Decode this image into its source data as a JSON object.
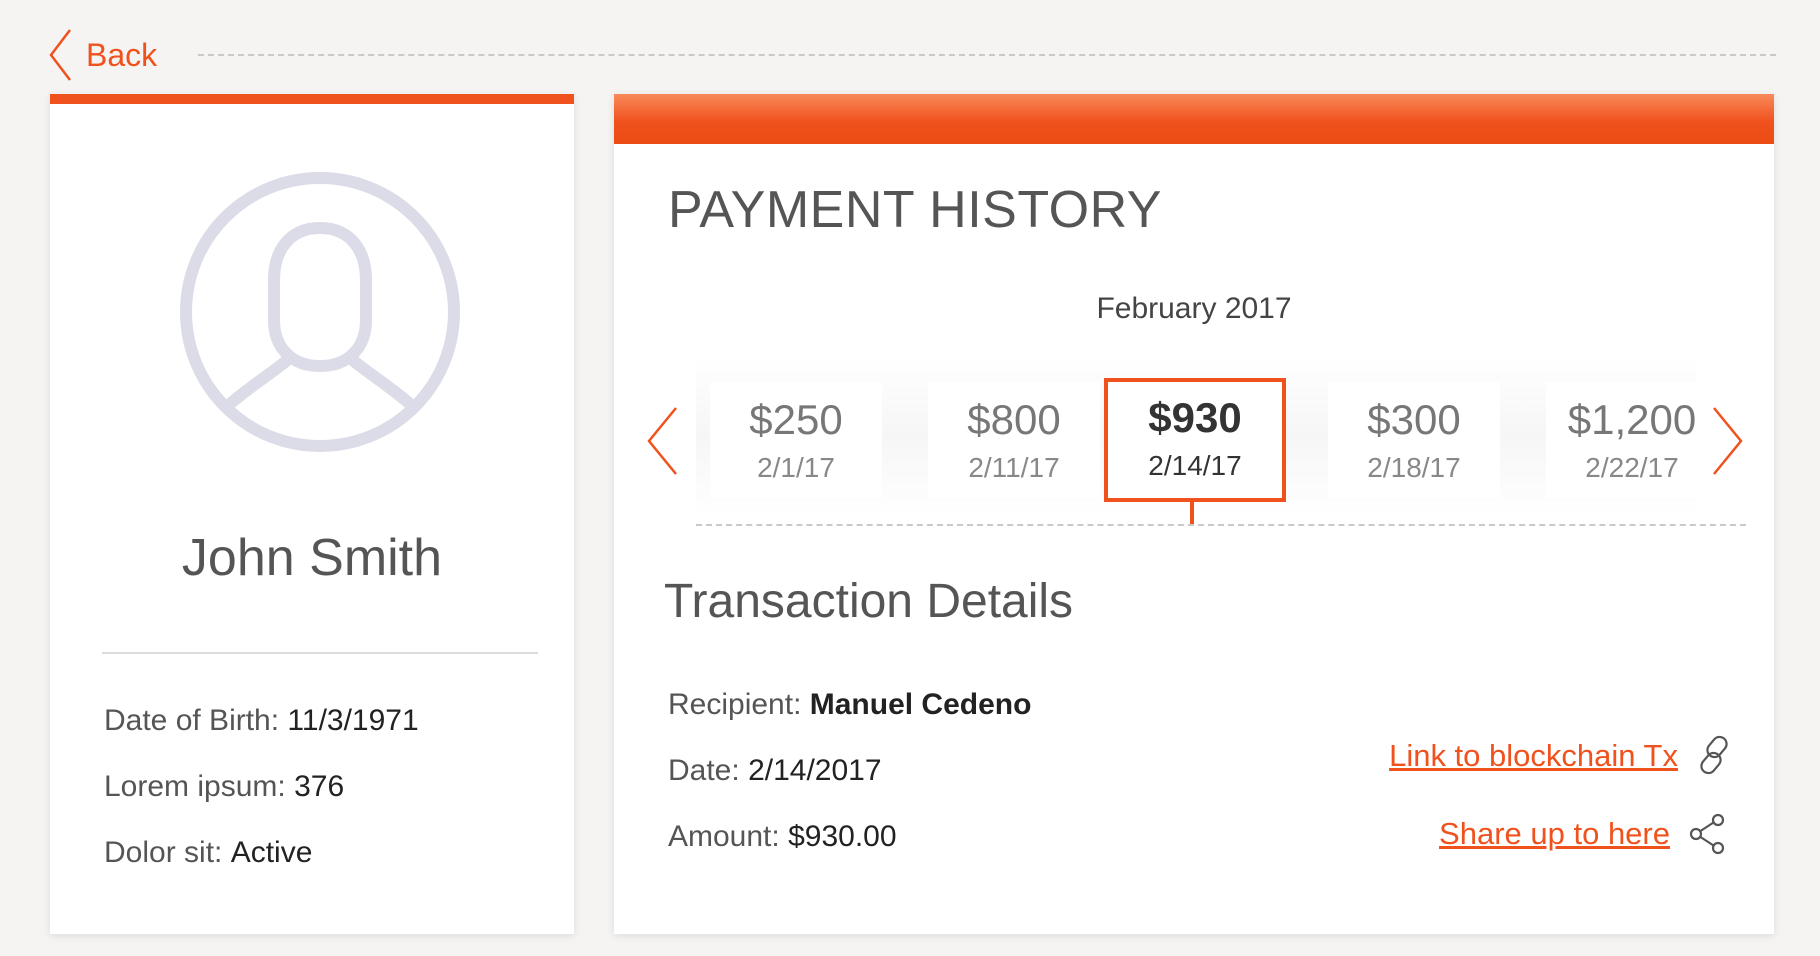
{
  "nav": {
    "back_label": "Back"
  },
  "profile": {
    "name": "John Smith",
    "fields": [
      {
        "label": "Date of Birth:",
        "value": "11/3/1971"
      },
      {
        "label": "Lorem ipsum:",
        "value": "376"
      },
      {
        "label": "Dolor sit:",
        "value": "Active"
      }
    ]
  },
  "payment_history": {
    "title": "PAYMENT HISTORY",
    "month": "February 2017",
    "items": [
      {
        "amount": "$250",
        "date": "2/1/17"
      },
      {
        "amount": "$800",
        "date": "2/11/17"
      },
      {
        "amount": "$930",
        "date": "2/14/17",
        "selected": true
      },
      {
        "amount": "$300",
        "date": "2/18/17"
      },
      {
        "amount": "$1,200",
        "date": "2/22/17"
      }
    ]
  },
  "transaction": {
    "title": "Transaction Details",
    "recipient_label": "Recipient:",
    "recipient_value": "Manuel Cedeno",
    "date_label": "Date:",
    "date_value": "2/14/2017",
    "amount_label": "Amount:",
    "amount_value": "$930.00",
    "blockchain_link": "Link to blockchain Tx",
    "share_link": "Share up to here"
  },
  "colors": {
    "accent": "#f0521e",
    "avatar": "#dcdbe8",
    "background": "#f5f4f2"
  },
  "icons": [
    "chevron-left-icon",
    "user-avatar-icon",
    "chevron-right-icon",
    "link-icon",
    "share-icon"
  ]
}
